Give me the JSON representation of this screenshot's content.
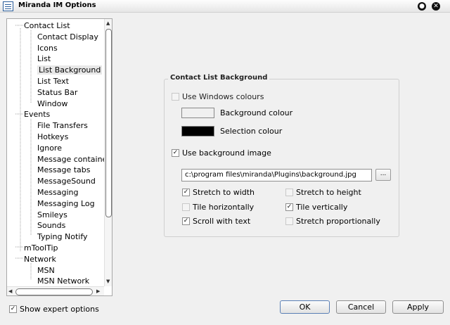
{
  "window": {
    "title": "Miranda IM Options",
    "minimize_glyph": "●",
    "close_glyph": "✕"
  },
  "tree": {
    "items": [
      {
        "label": "Contact List",
        "level": 1,
        "expander": "-"
      },
      {
        "label": "Contact Display",
        "level": 2
      },
      {
        "label": "Icons",
        "level": 2
      },
      {
        "label": "List",
        "level": 2
      },
      {
        "label": "List Background",
        "level": 2,
        "selected": true
      },
      {
        "label": "List Text",
        "level": 2
      },
      {
        "label": "Status Bar",
        "level": 2
      },
      {
        "label": "Window",
        "level": 2
      },
      {
        "label": "Events",
        "level": 1,
        "expander": "-"
      },
      {
        "label": "File Transfers",
        "level": 2
      },
      {
        "label": "Hotkeys",
        "level": 2
      },
      {
        "label": "Ignore",
        "level": 2
      },
      {
        "label": "Message containers",
        "level": 2
      },
      {
        "label": "Message tabs",
        "level": 2
      },
      {
        "label": "MessageSound",
        "level": 2
      },
      {
        "label": "Messaging",
        "level": 2
      },
      {
        "label": "Messaging Log",
        "level": 2
      },
      {
        "label": "Smileys",
        "level": 2
      },
      {
        "label": "Sounds",
        "level": 2
      },
      {
        "label": "Typing Notify",
        "level": 2
      },
      {
        "label": "mToolTip",
        "level": 1
      },
      {
        "label": "Network",
        "level": 1,
        "expander": "-"
      },
      {
        "label": "MSN",
        "level": 2
      },
      {
        "label": "MSN Network",
        "level": 2
      }
    ]
  },
  "expert_options": {
    "label": "Show expert options",
    "checked": true
  },
  "panel": {
    "group_title": "Contact List Background",
    "use_windows_colours": {
      "label": "Use Windows colours",
      "checked": false,
      "enabled": false
    },
    "background_colour": {
      "label": "Background colour",
      "color": "#f0f0f0"
    },
    "selection_colour": {
      "label": "Selection colour",
      "color": "#000000"
    },
    "use_background_image": {
      "label": "Use background image",
      "checked": true
    },
    "image_path": "c:\\program files\\miranda\\Plugins\\background.jpg",
    "browse_label": "...",
    "options": [
      {
        "label": "Stretch to width",
        "checked": true,
        "enabled": true
      },
      {
        "label": "Stretch to height",
        "checked": false,
        "enabled": false
      },
      {
        "label": "Tile horizontally",
        "checked": false,
        "enabled": false
      },
      {
        "label": "Tile vertically",
        "checked": true,
        "enabled": true
      },
      {
        "label": "Scroll with text",
        "checked": true,
        "enabled": true
      },
      {
        "label": "Stretch proportionally",
        "checked": false,
        "enabled": false
      }
    ]
  },
  "buttons": {
    "ok": "OK",
    "cancel": "Cancel",
    "apply": "Apply"
  }
}
